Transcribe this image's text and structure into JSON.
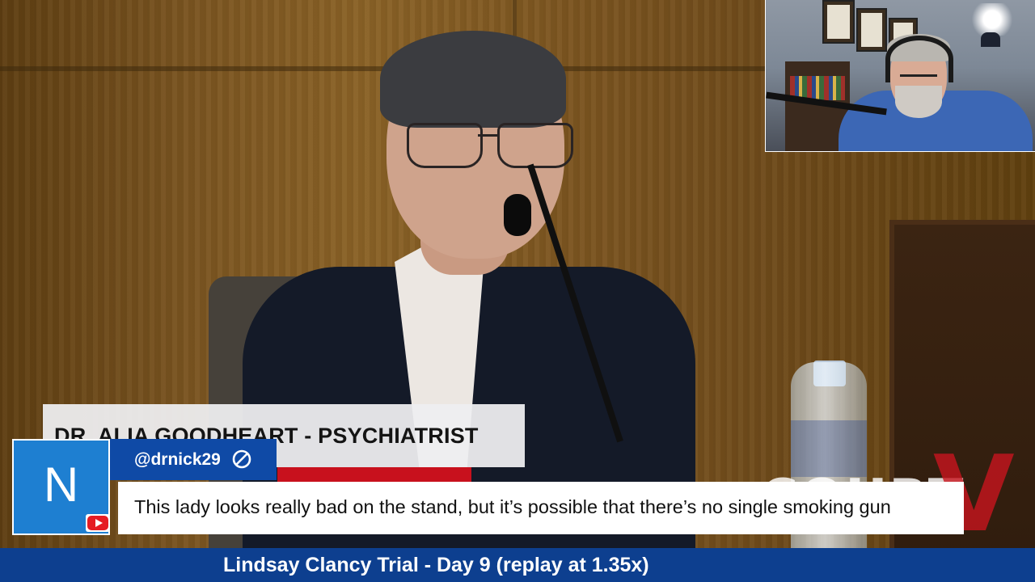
{
  "video": {
    "lower_third": {
      "name": "DR. ALIA GOODHEART - PSYCHIATRIST"
    },
    "watermark": {
      "text": "COURT",
      "mark": "V"
    }
  },
  "chat": {
    "avatar_letter": "N",
    "platform_icon": "youtube-icon",
    "username": "@drnick29",
    "moderator_icon": "slash-circle-icon",
    "message": "This lady looks really bad on the stand, but it’s possible that there’s no single smoking gun"
  },
  "title_bar": {
    "text": "Lindsay Clancy Trial - Day 9 (replay at 1.35x)"
  },
  "colors": {
    "title_bar_bg": "#0d3f8f",
    "username_bar_bg": "#0f4aa6",
    "avatar_bg": "#1e7fd1",
    "accent_red": "#c8111d"
  }
}
